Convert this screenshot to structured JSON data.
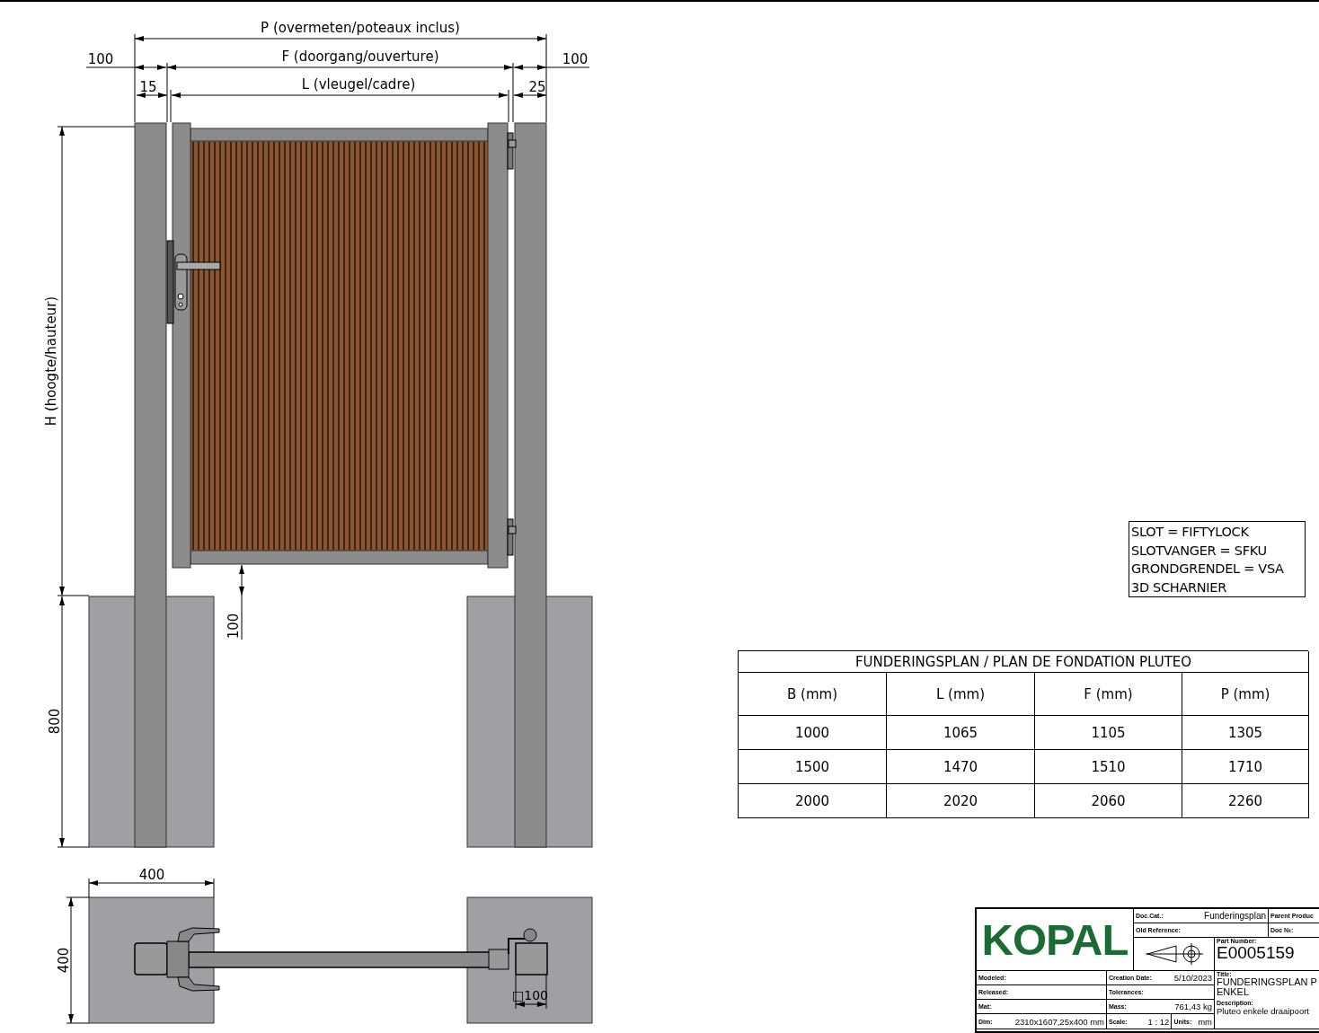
{
  "elevation_dimensions": [
    "P (overmeten/poteaux inclus)",
    "100",
    "F (doorgang/ouverture)",
    "100",
    "15",
    "L (vleugel/cadre)",
    "25",
    "H (hoogte/hauteur)",
    "100",
    "800"
  ],
  "plan_dimensions": [
    "400",
    "400",
    "□100"
  ],
  "notes": [
    "SLOT = FIFTYLOCK",
    "SLOTVANGER = SFKU",
    "GRONDGRENDEL = VSA",
    "3D SCHARNIER"
  ],
  "table": {
    "title": "FUNDERINGSPLAN / PLAN DE FONDATION PLUTEO",
    "columns": [
      "B (mm)",
      "L (mm)",
      "F (mm)",
      "P (mm)"
    ],
    "rows": [
      [
        "1000",
        "1065",
        "1105",
        "1305"
      ],
      [
        "1500",
        "1470",
        "1510",
        "1710"
      ],
      [
        "2000",
        "2020",
        "2060",
        "2260"
      ]
    ]
  },
  "title_block": {
    "logo": "KOPAL",
    "doc_cat": {
      "label": "Doc.Cat.:",
      "value": "Funderingsplan"
    },
    "parent_product": {
      "label": "Parent Produc"
    },
    "old_reference": {
      "label": "Old Reference:"
    },
    "doc_no": {
      "label": "Doc №:"
    },
    "part_number": {
      "label": "Part Number:",
      "value": "E0005159"
    },
    "modeled": {
      "label": "Modeled:"
    },
    "creation_date": {
      "label": "Creation Date:",
      "value": "5/10/2023"
    },
    "title": {
      "label": "Title:",
      "value": "FUNDERINGSPLAN P",
      "value_2": "ENKEL"
    },
    "released": {
      "label": "Released:"
    },
    "tolerances": {
      "label": "Tolerances:"
    },
    "mat": {
      "label": "Mat:"
    },
    "mass": {
      "label": "Mass:",
      "value": "761,43 kg"
    },
    "description": {
      "label": "Description:",
      "value": "Pluteo enkele draaipoort"
    },
    "dim": {
      "label": "Dim:",
      "value": "2310x1607,25x400 mm"
    },
    "scale": {
      "label": "Scale:",
      "value": "1 : 12"
    },
    "units": {
      "label": "Units:",
      "value": "mm"
    }
  }
}
